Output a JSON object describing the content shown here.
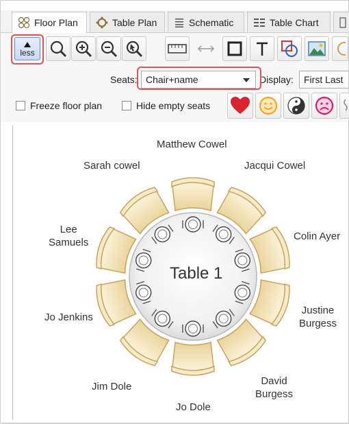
{
  "tabs": [
    {
      "label": "Floor Plan",
      "icon": "circles-icon",
      "active": true
    },
    {
      "label": "Table Plan",
      "icon": "ring-icon",
      "active": false
    },
    {
      "label": "Schematic",
      "icon": "list-icon",
      "active": false
    },
    {
      "label": "Table Chart",
      "icon": "grid-icon",
      "active": false
    }
  ],
  "toolbar": {
    "less_label": "less",
    "tools": [
      "zoom-icon",
      "zoom-in-icon",
      "zoom-out-icon",
      "zoom-select-icon",
      "ruler-icon",
      "measure-arrow-icon",
      "rectangle-icon",
      "text-icon",
      "shapes-icon",
      "image-icon",
      "more-icon"
    ]
  },
  "seats": {
    "label": "Seats:",
    "value": "Chair+name",
    "display_label": "Display:",
    "display_value": "First Last"
  },
  "options": {
    "freeze_label": "Freeze floor plan",
    "hide_empty_label": "Hide empty seats",
    "emoji_buttons": [
      "heart-icon",
      "smile-icon",
      "yin-yang-icon",
      "frown-icon",
      "more-icon"
    ]
  },
  "table": {
    "name": "Table 1",
    "guests": [
      "Matthew Cowel",
      "Jacqui Cowel",
      "Colin Ayer",
      "Justine\nBurgess",
      "David\nBurgess",
      "Jo Dole",
      "Jim Dole",
      "Jo Jenkins",
      "Lee\nSamuels",
      "Sarah cowel"
    ]
  },
  "colors": {
    "highlight": "#e0535b",
    "chair_fill": "#f1e2b6",
    "chair_stroke": "#c9a35c",
    "heart": "#d9232e",
    "smile": "#f5a623",
    "frown": "#e0186c"
  }
}
